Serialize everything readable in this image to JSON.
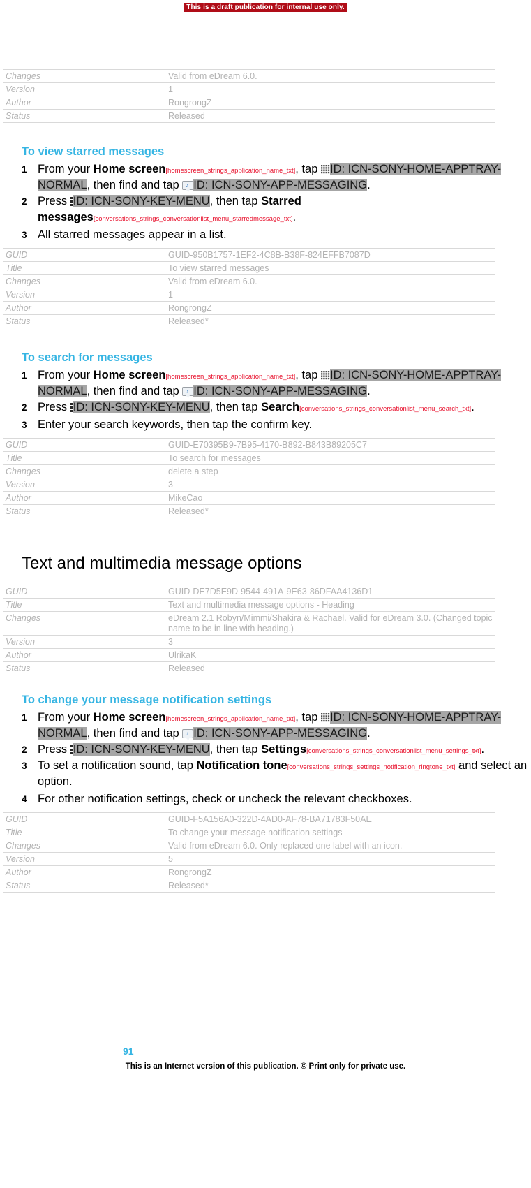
{
  "banner": {
    "text": "This is a draft publication for internal use only."
  },
  "top_table": {
    "rows": [
      {
        "key": "Changes",
        "value": "Valid from eDream 6.0."
      },
      {
        "key": "Version",
        "value": "1"
      },
      {
        "key": "Author",
        "value": "RongrongZ"
      },
      {
        "key": "Status",
        "value": "Released"
      }
    ]
  },
  "section_starred": {
    "heading": "To view starred messages",
    "steps": [
      {
        "num": "1",
        "parts": [
          {
            "t": "text",
            "v": "From your "
          },
          {
            "t": "bold",
            "v": "Home screen"
          },
          {
            "t": "strid",
            "v": "[homescreen_strings_application_name_txt]"
          },
          {
            "t": "text",
            "v": ", tap "
          },
          {
            "t": "icon",
            "v": "apptray-grid-icon"
          },
          {
            "t": "hl",
            "v": "ID: ICN-SONY-HOME-APPTRAY-NORMAL"
          },
          {
            "t": "text",
            "v": ", then find and tap "
          },
          {
            "t": "icon",
            "v": "messaging-app-icon"
          },
          {
            "t": "hl",
            "v": "ID: ICN-SONY-APP-MESSAGING"
          },
          {
            "t": "text",
            "v": "."
          }
        ]
      },
      {
        "num": "2",
        "parts": [
          {
            "t": "text",
            "v": "Press "
          },
          {
            "t": "icon",
            "v": "key-menu-icon"
          },
          {
            "t": "hl",
            "v": "ID: ICN-SONY-KEY-MENU"
          },
          {
            "t": "text",
            "v": ", then tap "
          },
          {
            "t": "bold",
            "v": "Starred messages"
          },
          {
            "t": "strid",
            "v": "[conversations_strings_conversationlist_menu_starredmessage_txt]"
          },
          {
            "t": "text",
            "v": "."
          }
        ]
      },
      {
        "num": "3",
        "parts": [
          {
            "t": "text",
            "v": "All starred messages appear in a list."
          }
        ]
      }
    ],
    "table": {
      "rows": [
        {
          "key": "GUID",
          "value": "GUID-950B1757-1EF2-4C8B-B38F-824EFFB7087D"
        },
        {
          "key": "Title",
          "value": "To view starred messages"
        },
        {
          "key": "Changes",
          "value": "Valid from eDream 6.0."
        },
        {
          "key": "Version",
          "value": "1"
        },
        {
          "key": "Author",
          "value": "RongrongZ"
        },
        {
          "key": "Status",
          "value": "Released*"
        }
      ]
    }
  },
  "section_search": {
    "heading": "To search for messages",
    "steps": [
      {
        "num": "1",
        "parts": [
          {
            "t": "text",
            "v": "From your "
          },
          {
            "t": "bold",
            "v": "Home screen"
          },
          {
            "t": "strid",
            "v": "[homescreen_strings_application_name_txt]"
          },
          {
            "t": "text",
            "v": ", tap "
          },
          {
            "t": "icon",
            "v": "apptray-grid-icon"
          },
          {
            "t": "hl",
            "v": "ID: ICN-SONY-HOME-APPTRAY-NORMAL"
          },
          {
            "t": "text",
            "v": ", then find and tap "
          },
          {
            "t": "icon",
            "v": "messaging-app-icon"
          },
          {
            "t": "hl",
            "v": "ID: ICN-SONY-APP-MESSAGING"
          },
          {
            "t": "text",
            "v": "."
          }
        ]
      },
      {
        "num": "2",
        "parts": [
          {
            "t": "text",
            "v": "Press "
          },
          {
            "t": "icon",
            "v": "key-menu-icon"
          },
          {
            "t": "hl",
            "v": "ID: ICN-SONY-KEY-MENU"
          },
          {
            "t": "text",
            "v": ", then tap "
          },
          {
            "t": "bold",
            "v": "Search"
          },
          {
            "t": "strid",
            "v": "[conversations_strings_conversationlist_menu_search_txt]"
          },
          {
            "t": "text",
            "v": "."
          }
        ]
      },
      {
        "num": "3",
        "parts": [
          {
            "t": "text",
            "v": "Enter your search keywords, then tap the confirm key."
          }
        ]
      }
    ],
    "table": {
      "rows": [
        {
          "key": "GUID",
          "value": "GUID-E70395B9-7B95-4170-B892-B843B89205C7"
        },
        {
          "key": "Title",
          "value": "To search for messages"
        },
        {
          "key": "Changes",
          "value": "delete a step"
        },
        {
          "key": "Version",
          "value": "3"
        },
        {
          "key": "Author",
          "value": "MikeCao"
        },
        {
          "key": "Status",
          "value": "Released*"
        }
      ]
    }
  },
  "chapter": {
    "heading": "Text and multimedia message options",
    "table": {
      "rows": [
        {
          "key": "GUID",
          "value": "GUID-DE7D5E9D-9544-491A-9E63-86DFAA4136D1"
        },
        {
          "key": "Title",
          "value": "Text and multimedia message options - Heading"
        },
        {
          "key": "Changes",
          "value": "eDream 2.1 Robyn/Mimmi/Shakira & Rachael. Valid for eDream 3.0. (Changed topic name to be in line with heading.)"
        },
        {
          "key": "Version",
          "value": "3"
        },
        {
          "key": "Author",
          "value": "UlrikaK"
        },
        {
          "key": "Status",
          "value": "Released"
        }
      ]
    }
  },
  "section_notification": {
    "heading": "To change your message notification settings",
    "steps": [
      {
        "num": "1",
        "parts": [
          {
            "t": "text",
            "v": "From your "
          },
          {
            "t": "bold",
            "v": "Home screen"
          },
          {
            "t": "strid",
            "v": "[homescreen_strings_application_name_txt]"
          },
          {
            "t": "text",
            "v": ", tap "
          },
          {
            "t": "icon",
            "v": "apptray-grid-icon"
          },
          {
            "t": "hl",
            "v": "ID: ICN-SONY-HOME-APPTRAY-NORMAL"
          },
          {
            "t": "text",
            "v": ", then find and tap "
          },
          {
            "t": "icon",
            "v": "messaging-app-icon"
          },
          {
            "t": "hl",
            "v": "ID: ICN-SONY-APP-MESSAGING"
          },
          {
            "t": "text",
            "v": "."
          }
        ]
      },
      {
        "num": "2",
        "parts": [
          {
            "t": "text",
            "v": "Press "
          },
          {
            "t": "icon",
            "v": "key-menu-icon"
          },
          {
            "t": "hl",
            "v": "ID: ICN-SONY-KEY-MENU"
          },
          {
            "t": "text",
            "v": ", then tap "
          },
          {
            "t": "bold",
            "v": "Settings"
          },
          {
            "t": "strid",
            "v": "[conversations_strings_conversationlist_menu_settings_txt]"
          },
          {
            "t": "text",
            "v": "."
          }
        ]
      },
      {
        "num": "3",
        "parts": [
          {
            "t": "text",
            "v": "To set a notification sound, tap "
          },
          {
            "t": "bold",
            "v": "Notification tone"
          },
          {
            "t": "strid",
            "v": "[conversations_strings_settings_notification_ringtone_txt]"
          },
          {
            "t": "text",
            "v": " and select an option."
          }
        ]
      },
      {
        "num": "4",
        "parts": [
          {
            "t": "text",
            "v": "For other notification settings, check or uncheck the relevant checkboxes."
          }
        ]
      }
    ],
    "table": {
      "rows": [
        {
          "key": "GUID",
          "value": "GUID-F5A156A0-322D-4AD0-AF78-BA71783F50AE"
        },
        {
          "key": "Title",
          "value": "To change your message notification settings"
        },
        {
          "key": "Changes",
          "value": "Valid from eDream 6.0. Only replaced one label with an icon."
        },
        {
          "key": "Version",
          "value": "5"
        },
        {
          "key": "Author",
          "value": "RongrongZ"
        },
        {
          "key": "Status",
          "value": "Released*"
        }
      ]
    }
  },
  "footer": {
    "page_number": "91",
    "note": "This is an Internet version of this publication. © Print only for private use."
  },
  "colors": {
    "banner_red": "#b00d18",
    "heading_blue": "#36b5e3",
    "string_id_red": "#e8112d",
    "highlight_gray": "#a6a6a6",
    "meta_text_gray": "#b3b3b3"
  }
}
